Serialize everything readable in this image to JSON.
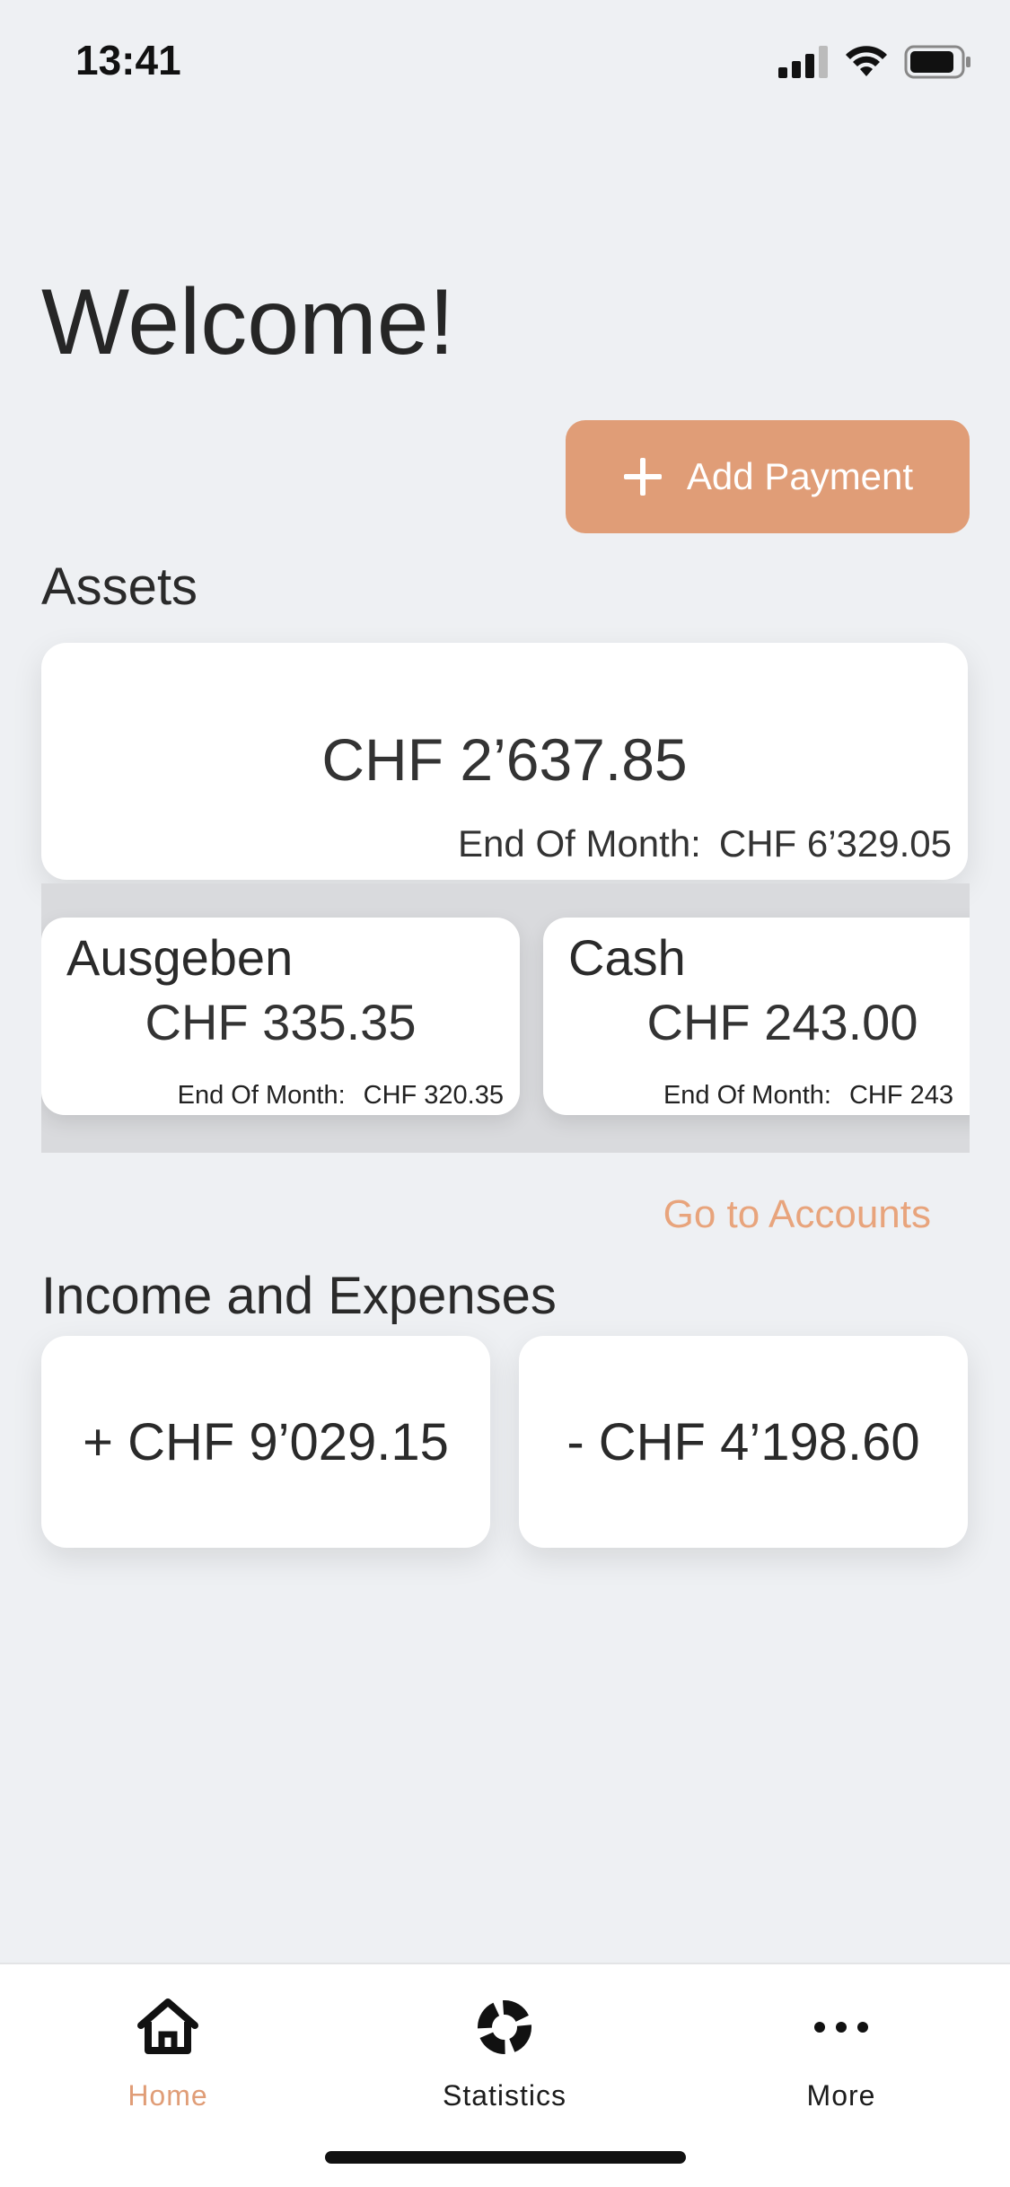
{
  "status_bar": {
    "time": "13:41"
  },
  "header": {
    "title": "Welcome!"
  },
  "add_payment": {
    "label": "Add Payment",
    "icon": "plus-icon"
  },
  "assets": {
    "title": "Assets",
    "total": "CHF 2’637.85",
    "end_of_month_label": "End Of Month:",
    "end_of_month_value": "CHF 6’329.05",
    "accounts": [
      {
        "name": "Ausgeben",
        "balance": "CHF 335.35",
        "eom_label": "End Of Month:",
        "eom_value": "CHF 320.35"
      },
      {
        "name": "Cash",
        "balance": "CHF 243.00",
        "eom_label": "End Of Month:",
        "eom_value": "CHF 243"
      }
    ],
    "go_to_accounts": "Go to Accounts"
  },
  "income_expenses": {
    "title": "Income and Expenses",
    "income": "+ CHF 9’029.15",
    "expenses": "- CHF 4’198.60"
  },
  "tabbar": {
    "items": [
      {
        "label": "Home",
        "icon": "home-icon",
        "active": true
      },
      {
        "label": "Statistics",
        "icon": "donut-chart-icon",
        "active": false
      },
      {
        "label": "More",
        "icon": "more-dots-icon",
        "active": false
      }
    ]
  },
  "colors": {
    "accent": "#e09d77",
    "link": "#e8a47c",
    "background": "#eef0f3"
  }
}
